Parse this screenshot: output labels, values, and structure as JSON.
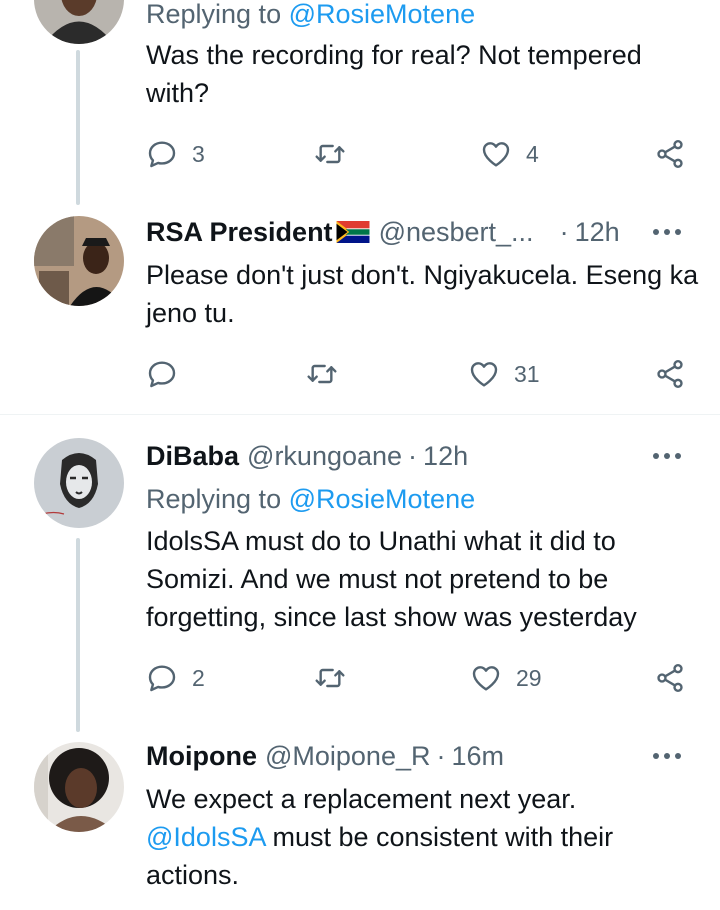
{
  "tweets": [
    {
      "replying_prefix": "Replying to",
      "replying_to": "@RosieMotene",
      "text": "Was the recording for real? Not tempered with?",
      "reply_count": "3",
      "retweet_count": "",
      "like_count": "4"
    },
    {
      "name": "RSA President",
      "handle": "@nesbert_...",
      "separator": "·",
      "time": "12h",
      "text": "Please don't just don't. Ngiyakucela. Eseng ka jeno tu.",
      "reply_count": "",
      "retweet_count": "",
      "like_count": "31"
    },
    {
      "name": "DiBaba",
      "handle": "@rkungoane",
      "separator": "·",
      "time": "12h",
      "replying_prefix": "Replying to",
      "replying_to": "@RosieMotene",
      "text": "IdolsSA must do to Unathi what it did to Somizi. And we must not pretend to be forgetting, since last show was yesterday",
      "reply_count": "2",
      "retweet_count": "",
      "like_count": "29"
    },
    {
      "name": "Moipone",
      "handle": "@Moipone_R",
      "separator": "·",
      "time": "16m",
      "mention": "@IdolsSA",
      "text_rest": " must be consistent with their actions.",
      "text_first": "We expect a replacement next year."
    }
  ],
  "icons": {
    "reply": "reply-icon",
    "retweet": "retweet-icon",
    "like": "heart-icon",
    "share": "share-icon",
    "more": "more-icon",
    "flag": "south-africa-flag-icon"
  },
  "colors": {
    "link": "#1d9bf0",
    "secondary": "#536471",
    "thread_line": "#cfd9de"
  }
}
